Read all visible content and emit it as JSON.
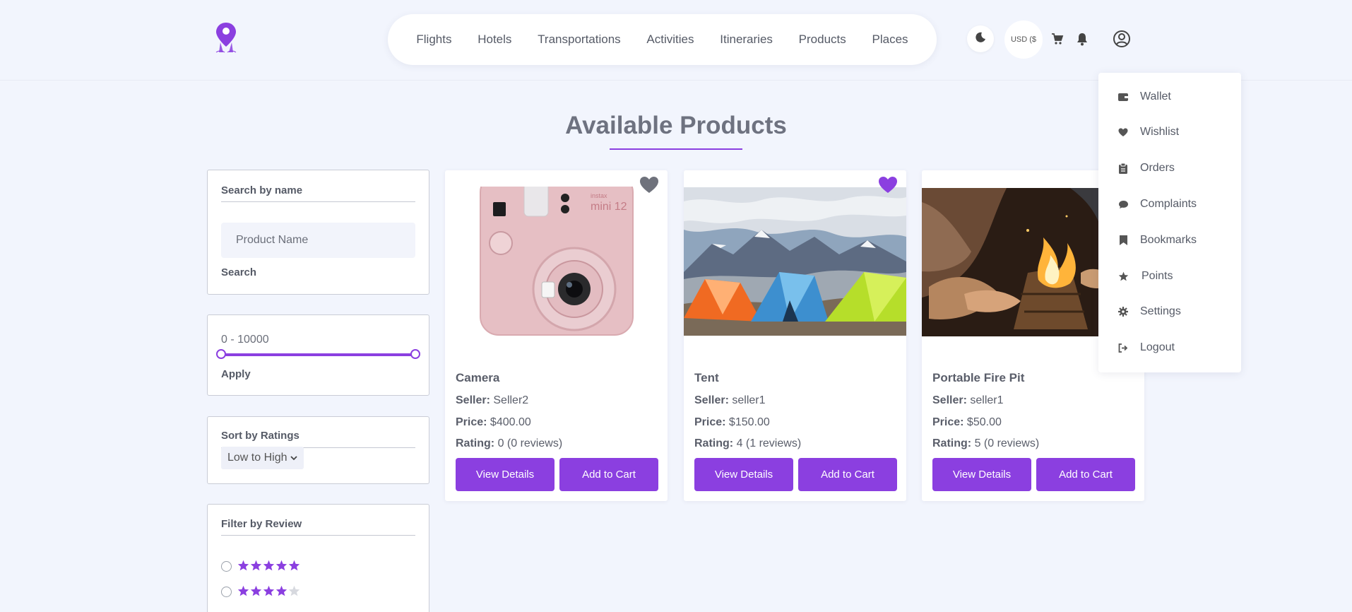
{
  "nav": {
    "items": [
      "Flights",
      "Hotels",
      "Transportations",
      "Activities",
      "Itineraries",
      "Products",
      "Places"
    ]
  },
  "header": {
    "currency": "USD ($",
    "icons": [
      "moon-icon",
      "cart-icon",
      "bell-icon",
      "user-circle-icon"
    ]
  },
  "page": {
    "title": "Available Products"
  },
  "filters": {
    "search_label": "Search by name",
    "search_placeholder": "Product Name",
    "search_button": "Search",
    "price_range": "0 - 10000",
    "price_min": 0,
    "price_max": 10000,
    "apply_button": "Apply",
    "sort_label": "Sort by Ratings",
    "sort_value": "Low to High",
    "review_label": "Filter by Review",
    "review_options": [
      5,
      4
    ]
  },
  "products": [
    {
      "name": "Camera",
      "seller_label": "Seller:",
      "seller": "Seller2",
      "price_label": "Price:",
      "price": "$400.00",
      "rating_label": "Rating:",
      "rating": "0 (0 reviews)",
      "wishlisted": false
    },
    {
      "name": "Tent",
      "seller_label": "Seller:",
      "seller": "seller1",
      "price_label": "Price:",
      "price": "$150.00",
      "rating_label": "Rating:",
      "rating": "4 (1 reviews)",
      "wishlisted": true
    },
    {
      "name": "Portable Fire Pit",
      "seller_label": "Seller:",
      "seller": "seller1",
      "price_label": "Price:",
      "price": "$50.00",
      "rating_label": "Rating:",
      "rating": "5 (0 reviews)",
      "wishlisted": false
    }
  ],
  "card_buttons": {
    "details": "View Details",
    "cart": "Add to Cart"
  },
  "dropdown": {
    "items": [
      {
        "label": "Wallet",
        "icon": "wallet-icon"
      },
      {
        "label": "Wishlist",
        "icon": "heart-icon"
      },
      {
        "label": "Orders",
        "icon": "clipboard-icon"
      },
      {
        "label": "Complaints",
        "icon": "chat-icon"
      },
      {
        "label": "Bookmarks",
        "icon": "bookmark-icon"
      },
      {
        "label": "Points",
        "icon": "star-icon"
      },
      {
        "label": "Settings",
        "icon": "gear-icon"
      },
      {
        "label": "Logout",
        "icon": "logout-icon"
      }
    ]
  },
  "colors": {
    "accent": "#8b3fe0",
    "background": "#f2f5fd",
    "text": "#555a66"
  }
}
